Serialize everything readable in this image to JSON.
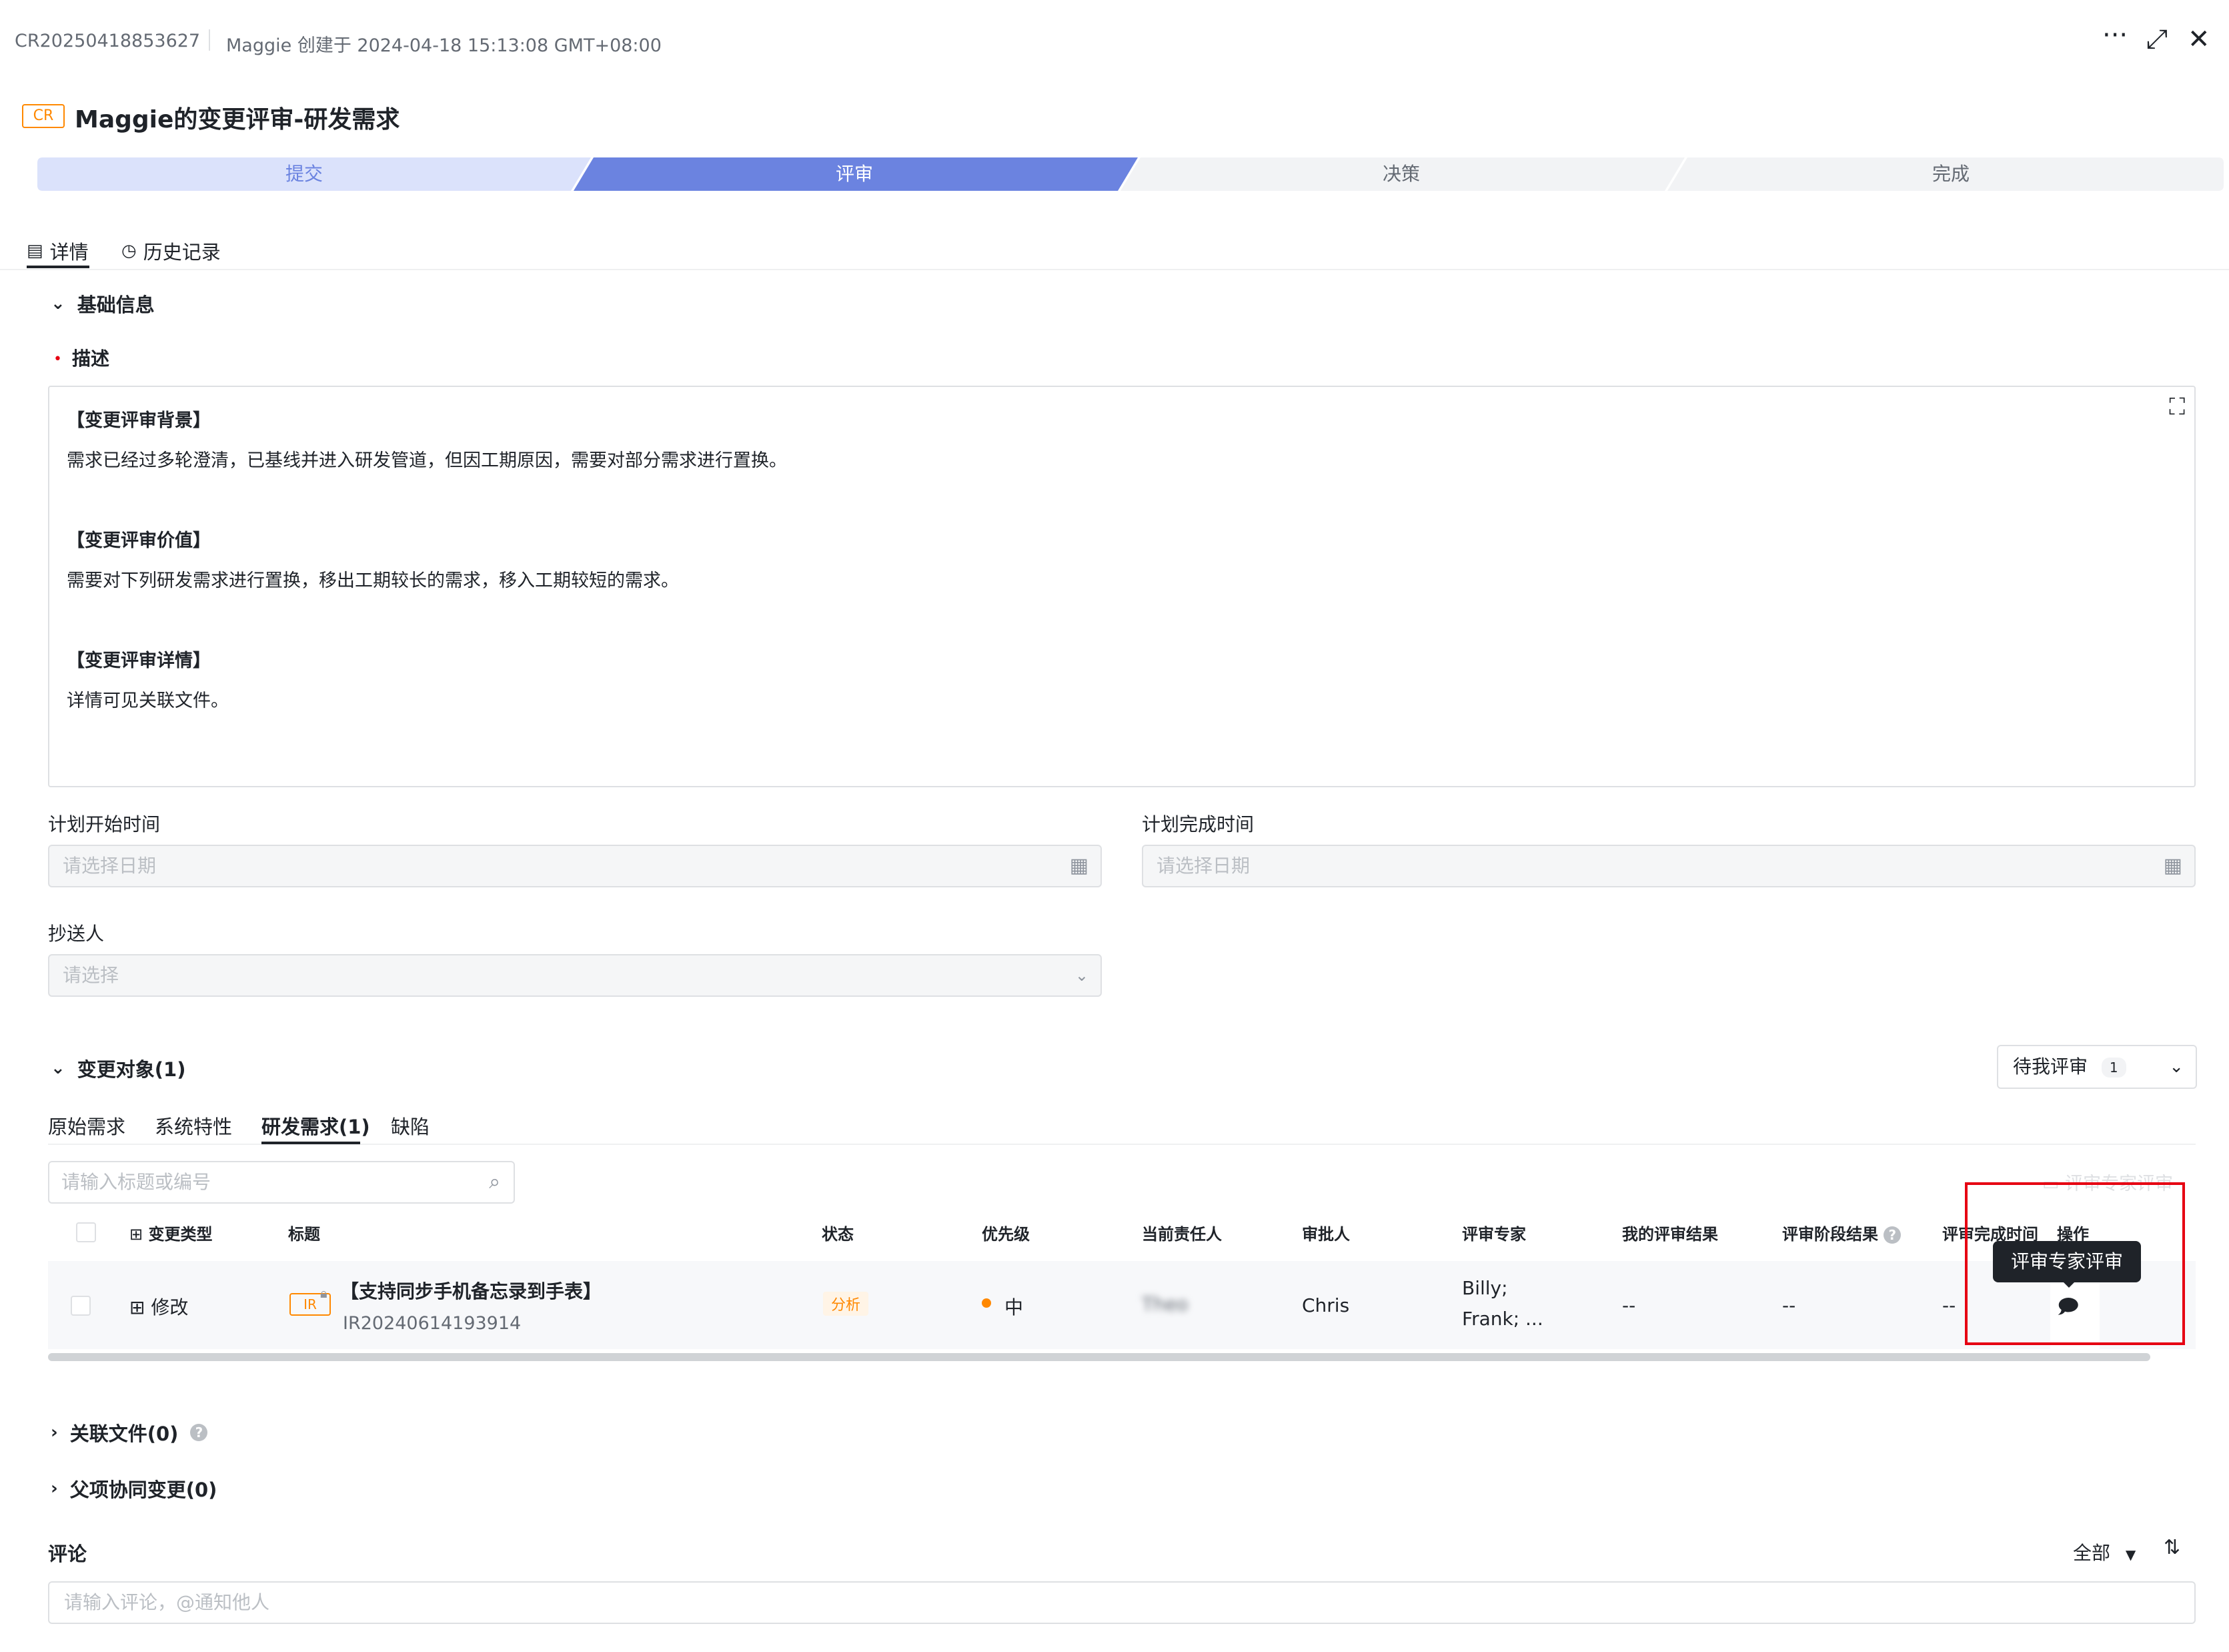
{
  "header": {
    "cr_id": "CR20250418853627",
    "created_info": "Maggie 创建于 2024-04-18 15:13:08 GMT+08:00",
    "more_icon": "···",
    "expand_icon": "⤢",
    "close_icon": "✕"
  },
  "title": {
    "tag": "CR",
    "text": "Maggie的变更评审-研发需求"
  },
  "steps": [
    {
      "label": "提交",
      "state": "done"
    },
    {
      "label": "评审",
      "state": "active"
    },
    {
      "label": "决策",
      "state": "todo"
    },
    {
      "label": "完成",
      "state": "todo"
    }
  ],
  "tabs": {
    "detail": "详情",
    "history": "历史记录"
  },
  "basic_info": {
    "title": "基础信息",
    "desc_label": "描述",
    "desc_lines": [
      "【变更评审背景】",
      "需求已经过多轮澄清，已基线并进入研发管道，但因工期原因，需要对部分需求进行置换。",
      "【变更评审价值】",
      "需要对下列研发需求进行置换，移出工期较长的需求，移入工期较短的需求。",
      "【变更评审详情】",
      "详情可见关联文件。"
    ],
    "plan_start_label": "计划开始时间",
    "plan_start_placeholder": "请选择日期",
    "plan_end_label": "计划完成时间",
    "plan_end_placeholder": "请选择日期",
    "cc_label": "抄送人",
    "cc_placeholder": "请选择"
  },
  "change_objects": {
    "title": "变更对象(1)",
    "filter_value": "待我评审",
    "filter_count": "1",
    "subtabs": [
      "原始需求",
      "系统特性",
      "研发需求(1)",
      "缺陷"
    ],
    "search_placeholder": "请输入标题或编号",
    "columns": [
      "变更类型",
      "标题",
      "状态",
      "优先级",
      "当前责任人",
      "审批人",
      "评审专家",
      "我的评审结果",
      "评审阶段结果",
      "评审完成时间",
      "操作"
    ],
    "row": {
      "change_type": "修改",
      "item_tag": "IR",
      "title": "【支持同步手机备忘录到手表】",
      "code": "IR20240614193914",
      "status": "分析",
      "priority": "中",
      "owner": "Theo",
      "approver": "Chris",
      "experts_line1": "Billy;",
      "experts_line2": "Frank; ...",
      "my_result": "--",
      "stage_result": "--",
      "finish_time": "--"
    },
    "tooltip": "评审专家评审",
    "faded_action": "评审专家评审"
  },
  "collapsed_sections": {
    "related_files": "关联文件(0)",
    "parent_changes": "父项协同变更(0)"
  },
  "comments": {
    "title": "评论",
    "filter": "全部",
    "placeholder": "请输入评论，@通知他人"
  },
  "colors": {
    "accent": "#6b83e0",
    "done_step": "#dbe2fb",
    "todo_step": "#f2f3f5",
    "warning": "#ff8800",
    "highlight": "#e60012"
  }
}
